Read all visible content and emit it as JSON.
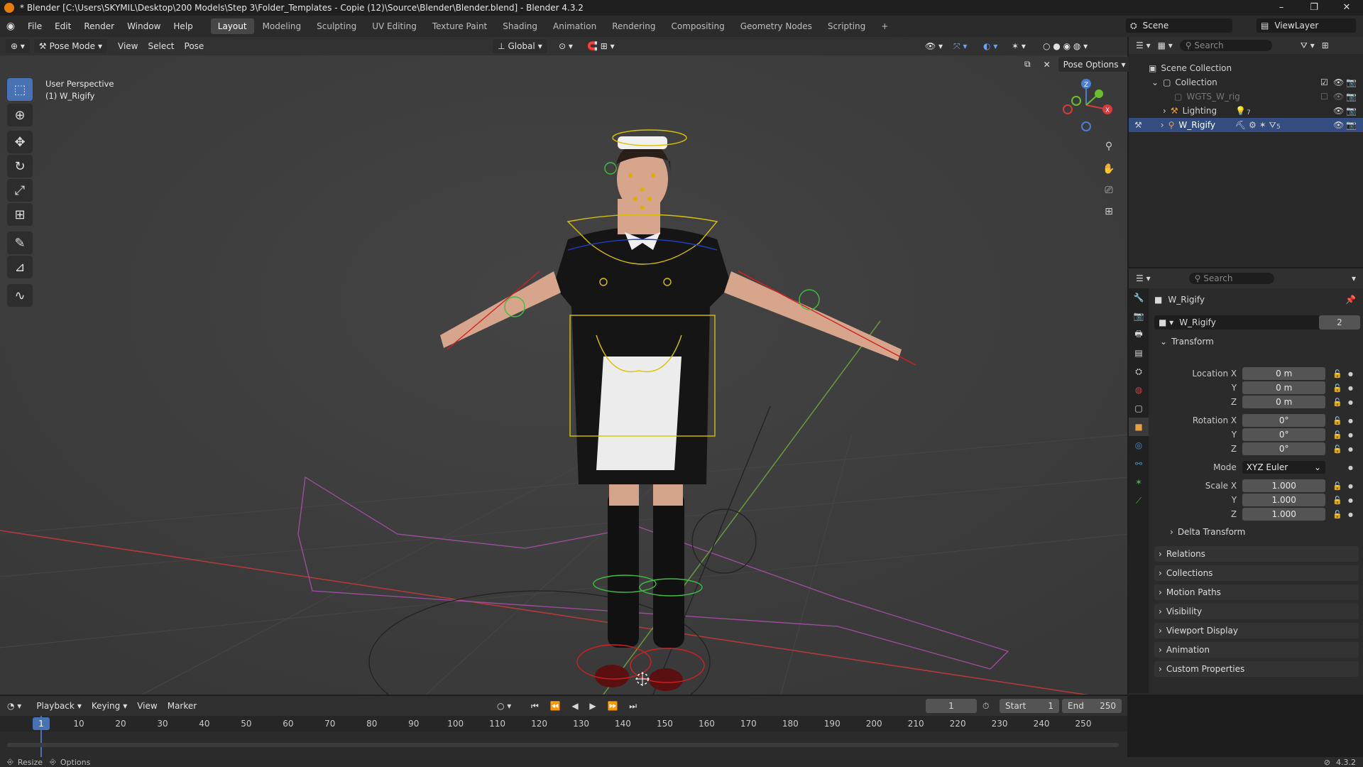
{
  "title_bar": {
    "text": "* Blender [C:\\Users\\SKYMIL\\Desktop\\200 Models\\Step 3\\Folder_Templates - Copie (12)\\Source\\Blender\\Blender.blend] - Blender 4.3.2",
    "minimize": "–",
    "maximize": "❐",
    "close": "✕"
  },
  "menu": [
    "File",
    "Edit",
    "Render",
    "Window",
    "Help"
  ],
  "workspaces": [
    "Layout",
    "Modeling",
    "Sculpting",
    "UV Editing",
    "Texture Paint",
    "Shading",
    "Animation",
    "Rendering",
    "Compositing",
    "Geometry Nodes",
    "Scripting"
  ],
  "active_workspace": "Layout",
  "scene": {
    "name": "Scene",
    "view_layer": "ViewLayer"
  },
  "viewport_header": {
    "mode": "Pose Mode",
    "menus": [
      "View",
      "Select",
      "Pose"
    ],
    "orientation": "Global",
    "pose_options": "Pose Options"
  },
  "viewport_overlay": {
    "perspective": "User Perspective",
    "object": "(1) W_Rigify"
  },
  "outliner": {
    "search_placeholder": "Search",
    "root": "Scene Collection",
    "collection": "Collection",
    "items": [
      {
        "name": "WGTS_W_rig",
        "badge": ""
      },
      {
        "name": "Lighting",
        "badge": "7"
      },
      {
        "name": "W_Rigify",
        "badge": "5"
      }
    ]
  },
  "properties": {
    "search_placeholder": "Search",
    "object_name": "W_Rigify",
    "datablock": "W_Rigify",
    "users": "2",
    "transform_title": "Transform",
    "location": {
      "label": "Location X",
      "x": "0 m",
      "y": "0 m",
      "z": "0 m"
    },
    "rotation": {
      "label": "Rotation X",
      "x": "0°",
      "y": "0°",
      "z": "0°"
    },
    "mode_label": "Mode",
    "mode_value": "XYZ Euler",
    "scale": {
      "label": "Scale X",
      "x": "1.000",
      "y": "1.000",
      "z": "1.000"
    },
    "axis_y": "Y",
    "axis_z": "Z",
    "delta_transform": "Delta Transform",
    "panels": [
      "Relations",
      "Collections",
      "Motion Paths",
      "Visibility",
      "Viewport Display",
      "Animation",
      "Custom Properties"
    ]
  },
  "timeline": {
    "menus": [
      "Playback",
      "Keying",
      "View",
      "Marker"
    ],
    "current_frame": "1",
    "start_label": "Start",
    "start": "1",
    "end_label": "End",
    "end": "250",
    "ticks": [
      "1",
      "10",
      "20",
      "30",
      "40",
      "50",
      "60",
      "70",
      "80",
      "90",
      "100",
      "110",
      "120",
      "130",
      "140",
      "150",
      "160",
      "170",
      "180",
      "190",
      "200",
      "210",
      "220",
      "230",
      "240",
      "250"
    ]
  },
  "statusbar": {
    "resize": "Resize",
    "options": "Options",
    "version": "4.3.2"
  },
  "colors": {
    "accent": "#4772b3",
    "selected_row": "#334d80",
    "bone_yellow": "#e6c700",
    "bone_red": "#d02020",
    "bone_green": "#3fbf3f"
  }
}
